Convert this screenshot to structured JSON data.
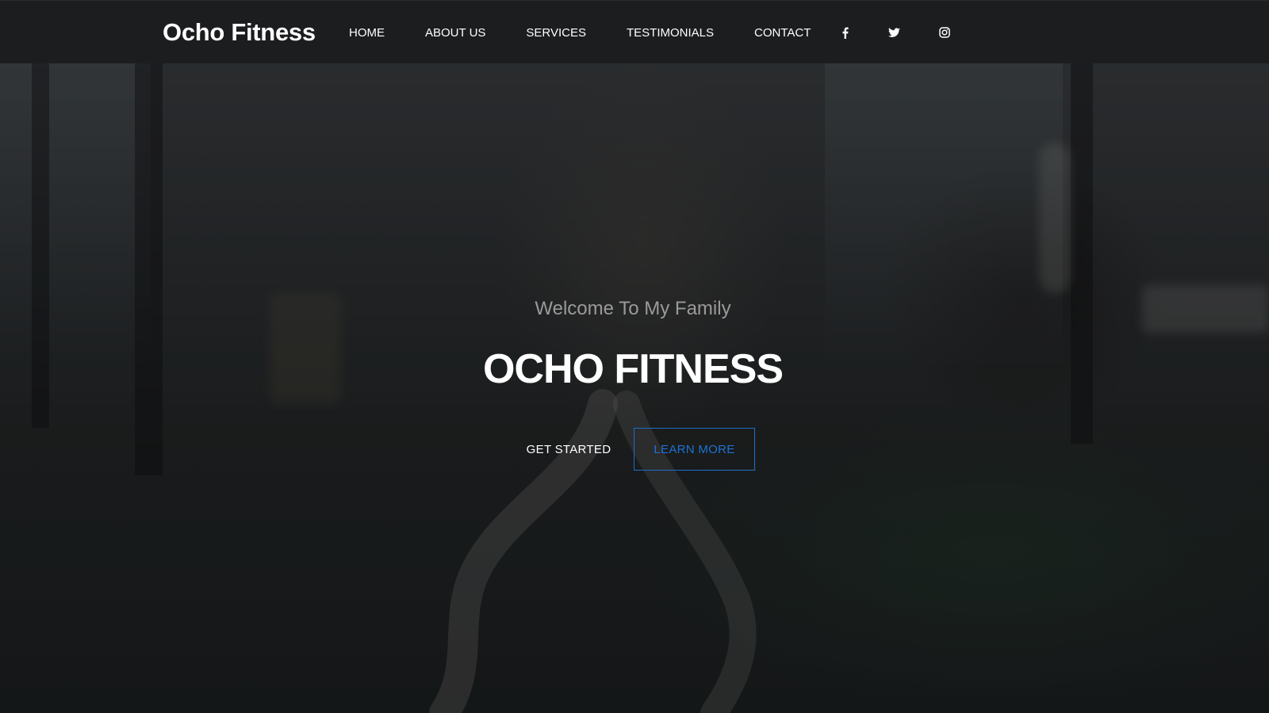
{
  "navbar": {
    "brand": "Ocho Fitness",
    "links": [
      {
        "label": "HOME"
      },
      {
        "label": "ABOUT US"
      },
      {
        "label": "SERVICES"
      },
      {
        "label": "TESTIMONIALS"
      },
      {
        "label": "CONTACT"
      }
    ],
    "social": [
      {
        "icon": "facebook-icon"
      },
      {
        "icon": "twitter-icon"
      },
      {
        "icon": "instagram-icon"
      }
    ]
  },
  "hero": {
    "subtitle": "Welcome To My Family",
    "title": "OCHO FITNESS",
    "primary_button": "GET STARTED",
    "secondary_button": "LEARN MORE"
  },
  "colors": {
    "navbar_bg": "#1c1d1f",
    "text_primary": "#ffffff",
    "subtitle": "#9a9a9a",
    "accent_blue": "#1e72d2"
  }
}
